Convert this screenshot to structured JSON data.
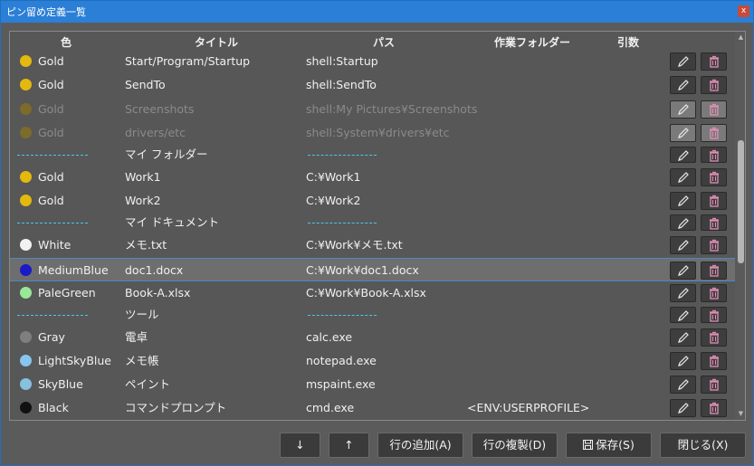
{
  "window": {
    "title": "ピン留め定義一覧",
    "close_label": "x"
  },
  "grid": {
    "headers": {
      "color": "色",
      "title": "タイトル",
      "path": "パス",
      "workdir": "作業フォルダー",
      "args": "引数"
    },
    "rows": [
      {
        "type": "item",
        "color_name": "Gold",
        "color_hex": "#e3b90e",
        "title": "Start/Program/Startup",
        "path": "shell:Startup",
        "workdir": "",
        "args": "",
        "disabled": false
      },
      {
        "type": "item",
        "color_name": "Gold",
        "color_hex": "#e3b90e",
        "title": "SendTo",
        "path": "shell:SendTo",
        "workdir": "",
        "args": "",
        "disabled": false
      },
      {
        "type": "item",
        "color_name": "Gold",
        "color_hex": "#7d6b2a",
        "title": "Screenshots",
        "path": "shell:My Pictures¥Screenshots",
        "workdir": "",
        "args": "",
        "disabled": true
      },
      {
        "type": "item",
        "color_name": "Gold",
        "color_hex": "#7d6b2a",
        "title": "drivers/etc",
        "path": "shell:System¥drivers¥etc",
        "workdir": "",
        "args": "",
        "disabled": true
      },
      {
        "type": "separator",
        "title": "マイ フォルダー"
      },
      {
        "type": "item",
        "color_name": "Gold",
        "color_hex": "#e3b90e",
        "title": "Work1",
        "path": "C:¥Work1",
        "workdir": "",
        "args": "",
        "disabled": false
      },
      {
        "type": "item",
        "color_name": "Gold",
        "color_hex": "#e3b90e",
        "title": "Work2",
        "path": "C:¥Work2",
        "workdir": "",
        "args": "",
        "disabled": false
      },
      {
        "type": "separator",
        "title": "マイ ドキュメント"
      },
      {
        "type": "item",
        "color_name": "White",
        "color_hex": "#f2f2f2",
        "title": "メモ.txt",
        "path": "C:¥Work¥メモ.txt",
        "workdir": "",
        "args": "",
        "disabled": false
      },
      {
        "type": "item",
        "color_name": "MediumBlue",
        "color_hex": "#1a1ac8",
        "title": "doc1.docx",
        "path": "C:¥Work¥doc1.docx",
        "workdir": "",
        "args": "",
        "disabled": false,
        "selected": true
      },
      {
        "type": "item",
        "color_name": "PaleGreen",
        "color_hex": "#98e898",
        "title": "Book-A.xlsx",
        "path": "C:¥Work¥Book-A.xlsx",
        "workdir": "",
        "args": "",
        "disabled": false
      },
      {
        "type": "separator",
        "title": "ツール"
      },
      {
        "type": "item",
        "color_name": "Gray",
        "color_hex": "#7f7f7f",
        "title": "電卓",
        "path": "calc.exe",
        "workdir": "",
        "args": "",
        "disabled": false
      },
      {
        "type": "item",
        "color_name": "LightSkyBlue",
        "color_hex": "#86c6ef",
        "title": "メモ帳",
        "path": "notepad.exe",
        "workdir": "",
        "args": "",
        "disabled": false
      },
      {
        "type": "item",
        "color_name": "SkyBlue",
        "color_hex": "#86c1e0",
        "title": "ペイント",
        "path": "mspaint.exe",
        "workdir": "",
        "args": "",
        "disabled": false
      },
      {
        "type": "item",
        "color_name": "Black",
        "color_hex": "#111111",
        "title": "コマンドプロンプト",
        "path": "cmd.exe",
        "workdir": "<ENV:USERPROFILE>",
        "args": "",
        "disabled": false
      }
    ],
    "separator_dashes": "----------------"
  },
  "footer": {
    "down_label": "↓",
    "up_label": "↑",
    "add_row_label": "行の追加(A)",
    "duplicate_row_label": "行の複製(D)",
    "save_label": "保存(S)",
    "close_label": "閉じる(X)"
  },
  "icons": {
    "edit": "pencil-icon",
    "delete": "trash-icon",
    "save": "floppy-disk-icon"
  },
  "colors": {
    "titlebar": "#2b7fd6",
    "separator_line": "#4cc6e8",
    "trash_icon": "#e08fb6"
  }
}
